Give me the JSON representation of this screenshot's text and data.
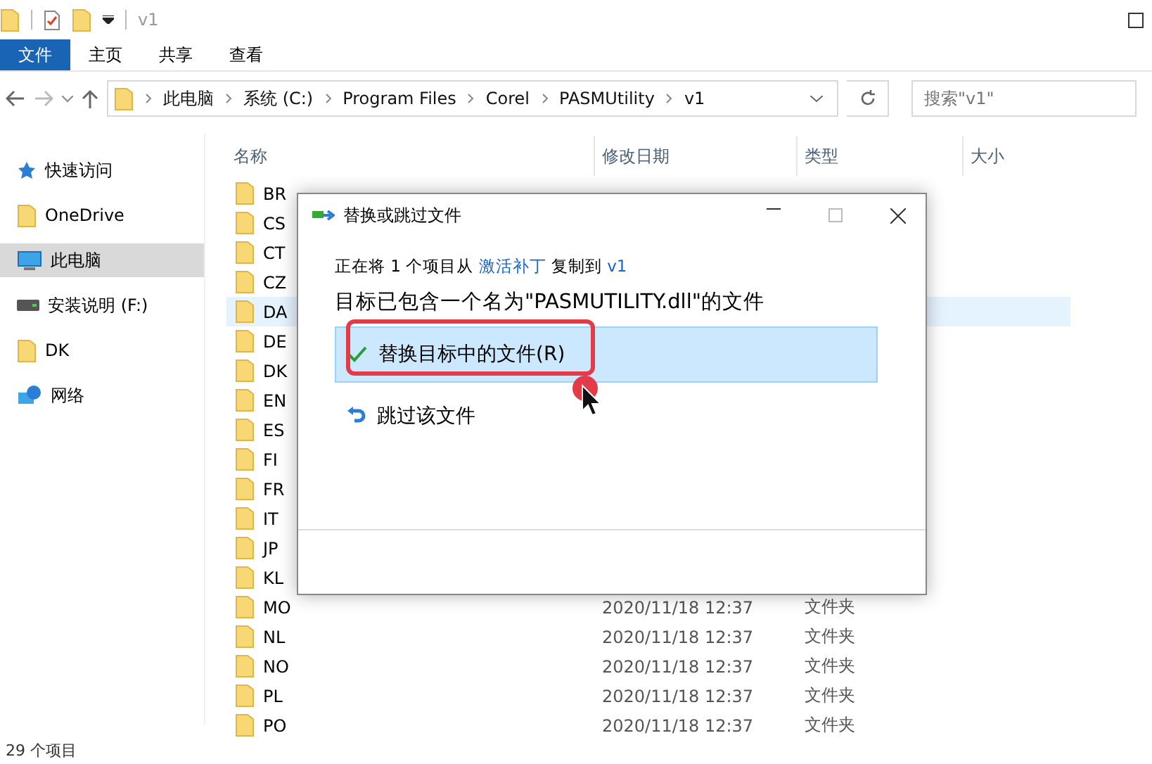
{
  "window": {
    "title": "v1"
  },
  "ribbon_tabs": [
    {
      "label": "文件",
      "selected": true
    },
    {
      "label": "主页",
      "selected": false
    },
    {
      "label": "共享",
      "selected": false
    },
    {
      "label": "查看",
      "selected": false
    }
  ],
  "address": [
    "此电脑",
    "系统 (C:)",
    "Program Files",
    "Corel",
    "PASMUtility",
    "v1"
  ],
  "search": {
    "placeholder": "搜索\"v1\""
  },
  "sidebar": {
    "items": [
      {
        "label": "快速访问",
        "kind": "star",
        "selected": false
      },
      {
        "label": "OneDrive",
        "kind": "folder",
        "selected": false
      },
      {
        "label": "此电脑",
        "kind": "pc",
        "selected": true
      },
      {
        "label": "安装说明 (F:)",
        "kind": "drive",
        "selected": false
      },
      {
        "label": "DK",
        "kind": "folder",
        "selected": false
      },
      {
        "label": "网络",
        "kind": "network",
        "selected": false
      }
    ]
  },
  "columns": [
    "名称",
    "修改日期",
    "类型",
    "大小"
  ],
  "rows": [
    {
      "name": "BR",
      "selected": false
    },
    {
      "name": "CS",
      "selected": false
    },
    {
      "name": "CT",
      "selected": false
    },
    {
      "name": "CZ",
      "selected": false
    },
    {
      "name": "DA",
      "selected": true
    },
    {
      "name": "DE",
      "selected": false
    },
    {
      "name": "DK",
      "selected": false
    },
    {
      "name": "EN",
      "selected": false
    },
    {
      "name": "ES",
      "selected": false
    },
    {
      "name": "FI",
      "selected": false
    },
    {
      "name": "FR",
      "selected": false
    },
    {
      "name": "IT",
      "selected": false
    },
    {
      "name": "JP",
      "selected": false
    },
    {
      "name": "KL",
      "selected": false
    },
    {
      "name": "MO",
      "selected": false,
      "date": "2020/11/18 12:37",
      "type": "文件夹"
    },
    {
      "name": "NL",
      "selected": false,
      "date": "2020/11/18 12:37",
      "type": "文件夹"
    },
    {
      "name": "NO",
      "selected": false,
      "date": "2020/11/18 12:37",
      "type": "文件夹"
    },
    {
      "name": "PL",
      "selected": false,
      "date": "2020/11/18 12:37",
      "type": "文件夹"
    },
    {
      "name": "PO",
      "selected": false,
      "date": "2020/11/18 12:37",
      "type": "文件夹"
    }
  ],
  "status_bar": "29 个项目",
  "dialog": {
    "title": "替换或跳过文件",
    "info": [
      "正在将 1 个项目从 ",
      "激活补丁",
      " 复制到 ",
      "v1"
    ],
    "heading": "目标已包含一个名为\"PASMUTILITY.dll\"的文件",
    "options": [
      {
        "label": "替换目标中的文件(R)",
        "kind": "replace",
        "selected": true
      },
      {
        "label": "跳过该文件",
        "kind": "skip",
        "selected": false
      }
    ]
  }
}
